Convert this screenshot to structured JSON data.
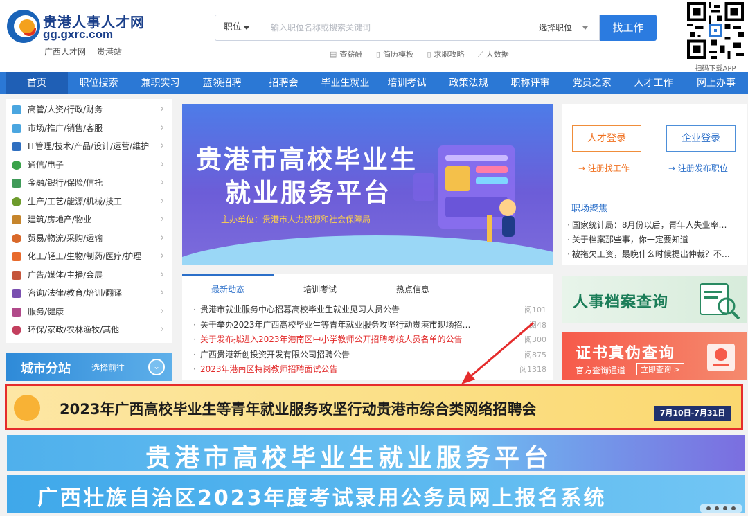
{
  "header": {
    "site_name": "贵港人事人才网",
    "domain": "gg.gxrc.com",
    "sub_links": [
      "广西人才网",
      "贵港站"
    ],
    "search": {
      "type_label": "职位",
      "placeholder": "输入职位名称或搜索关键词",
      "category_label": "选择职位",
      "button_label": "找工作"
    },
    "quick_links": [
      "查薪酬",
      "简历模板",
      "求职攻略",
      "大数据"
    ],
    "qr_label": "扫码下载APP"
  },
  "nav": [
    "首页",
    "职位搜索",
    "兼职实习",
    "蓝领招聘",
    "招聘会",
    "毕业生就业",
    "培训考试",
    "政策法规",
    "职称评审",
    "党员之家",
    "人才工作",
    "网上办事"
  ],
  "categories": [
    "高管/人资/行政/财务",
    "市场/推广/销售/客服",
    "IT管理/技术/产品/设计/运营/维护",
    "通信/电子",
    "金融/银行/保险/信托",
    "生产/工艺/能源/机械/技工",
    "建筑/房地产/物业",
    "贸易/物流/采购/运输",
    "化工/轻工/生物/制药/医疗/护理",
    "广告/媒体/主播/会展",
    "咨询/法律/教育/培训/翻译",
    "服务/健康",
    "环保/家政/农林渔牧/其他"
  ],
  "city_panel": {
    "title": "城市分站",
    "link": "选择前往"
  },
  "banner": {
    "title_line1": "贵港市高校毕业生",
    "title_line2": "就业服务平台",
    "organizer": "主办单位：贵港市人力资源和社会保障局"
  },
  "news": {
    "tabs": [
      "最新动态",
      "培训考试",
      "热点信息"
    ],
    "items": [
      {
        "text": "贵港市就业服务中心招募高校毕业生就业见习人员公告",
        "views": "阅101",
        "red": false
      },
      {
        "text": "关于举办2023年广西高校毕业生等青年就业服务攻坚行动贵港市现场招…",
        "views": "阅48",
        "red": false
      },
      {
        "text": "关于发布拟进入2023年港南区中小学教师公开招聘考核人员名单的公告",
        "views": "阅300",
        "red": true
      },
      {
        "text": "广西贵港新创投资开发有限公司招聘公告",
        "views": "阅875",
        "red": false
      },
      {
        "text": "2023年港南区特岗教师招聘面试公告",
        "views": "阅1318",
        "red": true
      }
    ]
  },
  "login": {
    "person_button": "人才登录",
    "company_button": "企业登录",
    "person_register": "→ 注册找工作",
    "company_register": "→ 注册发布职位"
  },
  "focus": {
    "title": "职场聚焦",
    "items": [
      "国家统计局：8月份以后，青年人失业率…",
      "关于档案那些事，你一定要知道",
      "被拖欠工资，最晚什么时候提出仲裁？不…"
    ]
  },
  "ads": {
    "archive_query": "人事档案查询",
    "cert_query": "证书真伪查询",
    "cert_channel": "官方查询通道",
    "cert_button": "立即查询 >"
  },
  "big_banners": {
    "job_fair": "2023年广西高校毕业生等青年就业服务攻坚行动贵港市综合类网络招聘会",
    "job_fair_date": "7月10日-7月31日",
    "platform": "贵港市高校毕业生就业服务平台",
    "civil_service": "广西壮族自治区2023年度考试录用公务员网上报名系统"
  },
  "colors": {
    "nav_blue": "#2b78d5",
    "accent_orange": "#f0701f",
    "highlight_red": "#e52c2c"
  }
}
